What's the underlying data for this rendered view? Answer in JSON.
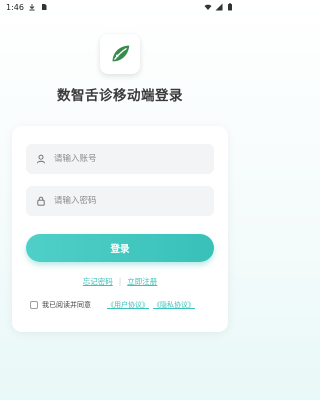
{
  "status_bar": {
    "time": "1:46"
  },
  "app": {
    "title": "数智舌诊移动端登录",
    "logo_color": "#3a8a4e"
  },
  "form": {
    "account_placeholder": "请输入账号",
    "password_placeholder": "请输入密码",
    "login_label": "登录",
    "accent_color": "#3cc2ba"
  },
  "links": {
    "forgot_password": "忘记密码",
    "separator": "|",
    "register": "立即注册"
  },
  "agreement": {
    "text": "我已阅读并同意",
    "user_agreement": "《用户协议》",
    "privacy_agreement": "《隐私协议》",
    "checked": false
  }
}
